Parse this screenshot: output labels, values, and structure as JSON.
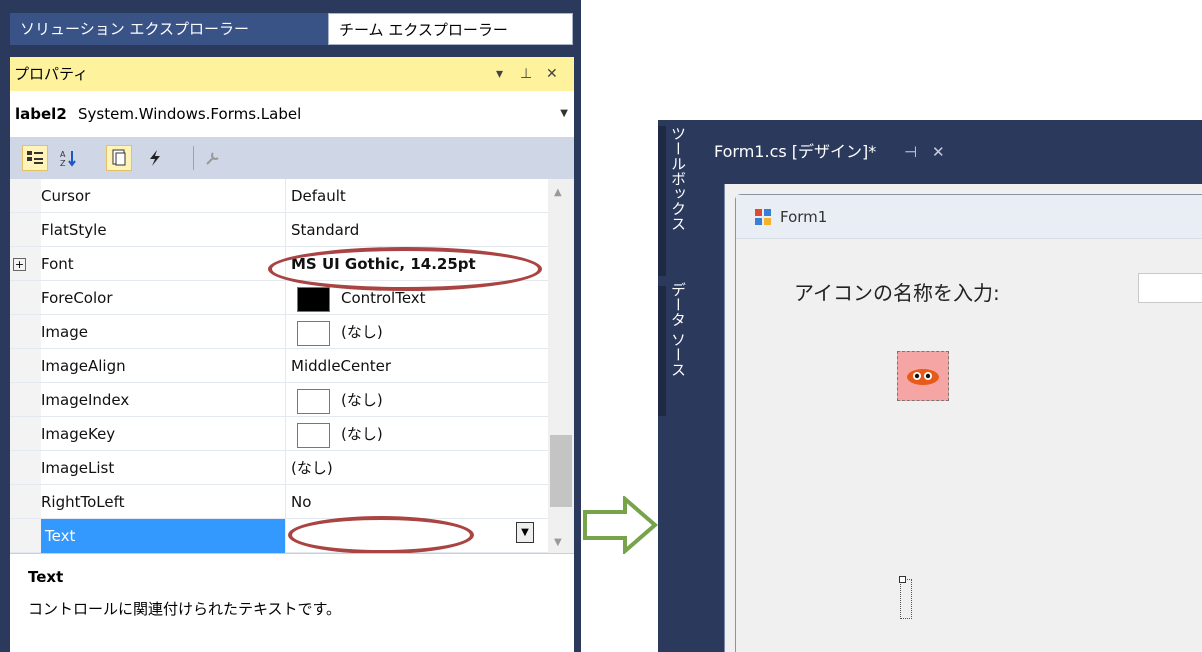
{
  "properties_window": {
    "tabs": [
      "ソリューション エクスプローラー",
      "チーム エクスプローラー"
    ],
    "title": "プロパティ",
    "title_buttons": [
      "▾",
      "⊥",
      "✕"
    ],
    "object_name": "label2",
    "object_type": "System.Windows.Forms.Label",
    "toolbar_icons": [
      "categorized-icon",
      "alphabetical-icon",
      "properties-icon",
      "events-icon",
      "property-pages-icon"
    ],
    "properties": [
      {
        "name": "Cursor",
        "value": "Default"
      },
      {
        "name": "FlatStyle",
        "value": "Standard"
      },
      {
        "name": "Font",
        "value": "MS UI Gothic, 14.25pt"
      },
      {
        "name": "ForeColor",
        "value": "ControlText"
      },
      {
        "name": "Image",
        "value": "(なし)"
      },
      {
        "name": "ImageAlign",
        "value": "MiddleCenter"
      },
      {
        "name": "ImageIndex",
        "value": "(なし)"
      },
      {
        "name": "ImageKey",
        "value": "(なし)"
      },
      {
        "name": "ImageList",
        "value": "(なし)"
      },
      {
        "name": "RightToLeft",
        "value": "No"
      },
      {
        "name": "Text",
        "value": ""
      }
    ],
    "description_title": "Text",
    "description_text": "コントロールに関連付けられたテキストです。",
    "colors": {
      "highlight": "#a94442",
      "selection": "#3399ff",
      "title_bar": "#fff29d"
    }
  },
  "designer_window": {
    "side_tabs": [
      "ツールボックス",
      "データ ソース"
    ],
    "doc_tab": "Form1.cs [デザイン]*",
    "doc_tab_buttons": [
      "⊣",
      "✕"
    ],
    "form_title": "Form1",
    "form_label": "アイコンの名称を入力:"
  },
  "arrow_color": "#77a34a"
}
